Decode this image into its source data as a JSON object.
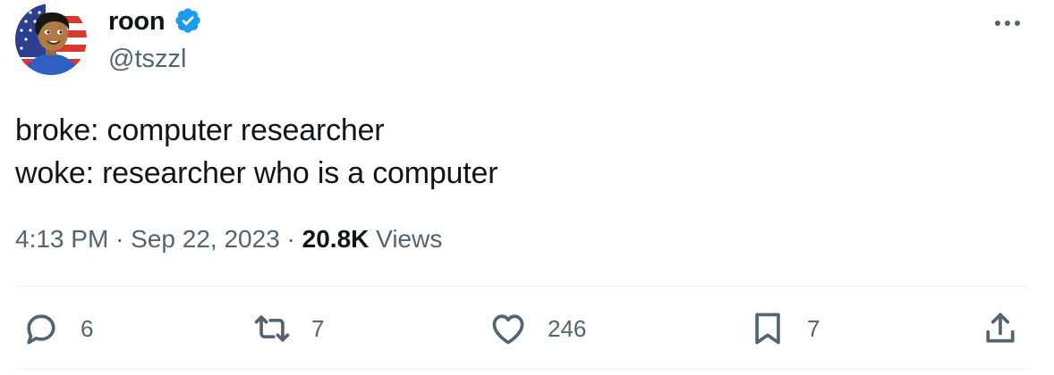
{
  "user": {
    "display_name": "roon",
    "handle": "@tszzl",
    "verified": true,
    "avatar": "avatar-cartoon-flag"
  },
  "tweet": {
    "lines": [
      "broke: computer researcher",
      "woke: researcher who is a computer"
    ],
    "time": "4:13 PM",
    "separator": "·",
    "date": "Sep 22, 2023",
    "views_count": "20.8K",
    "views_label": "Views"
  },
  "actions": {
    "reply": {
      "icon": "reply-icon",
      "count": "6"
    },
    "retweet": {
      "icon": "retweet-icon",
      "count": "7"
    },
    "like": {
      "icon": "heart-icon",
      "count": "246"
    },
    "bookmark": {
      "icon": "bookmark-icon",
      "count": "7"
    },
    "share": {
      "icon": "share-icon"
    }
  },
  "colors": {
    "text": "#0f1419",
    "secondary": "#536471",
    "verified_blue": "#1d9bf0",
    "divider": "#eff3f4"
  }
}
